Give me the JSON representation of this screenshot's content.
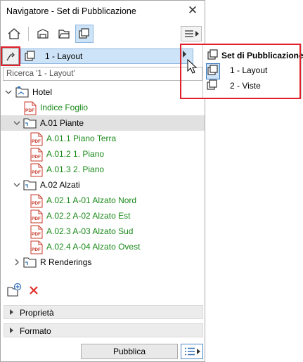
{
  "window": {
    "title": "Navigatore - Set di Pubblicazione",
    "close_symbol": "✕"
  },
  "toolbar": {
    "menu_icon": "hamburger-menu-icon"
  },
  "selector": {
    "label": "1 - Layout"
  },
  "search": {
    "placeholder": "Ricerca '1 - Layout'"
  },
  "tree": {
    "root": "Hotel",
    "index": "Indice Foglio",
    "folder1": "A.01 Piante",
    "f1_items": [
      "A.01.1 Piano Terra",
      "A.01.2 1. Piano",
      "A.01.3 2. Piano"
    ],
    "folder2": "A.02 Alzati",
    "f2_items": [
      "A.02.1 A-01 Alzato Nord",
      "A.02.2 A-02 Alzato Est",
      "A.02.3 A-03 Alzato Sud",
      "A.02.4 A-04 Alzato Ovest"
    ],
    "folder3": "R Renderings"
  },
  "sections": {
    "properties": "Proprietà",
    "format": "Formato"
  },
  "footer": {
    "publish": "Pubblica"
  },
  "popup": {
    "title": "Set di Pubblicazione",
    "items": [
      "1 - Layout",
      "2 - Viste"
    ]
  },
  "colors": {
    "accent": "#cde3f7",
    "highlight_border": "#e0202a",
    "item_text": "#1a8a1a"
  }
}
